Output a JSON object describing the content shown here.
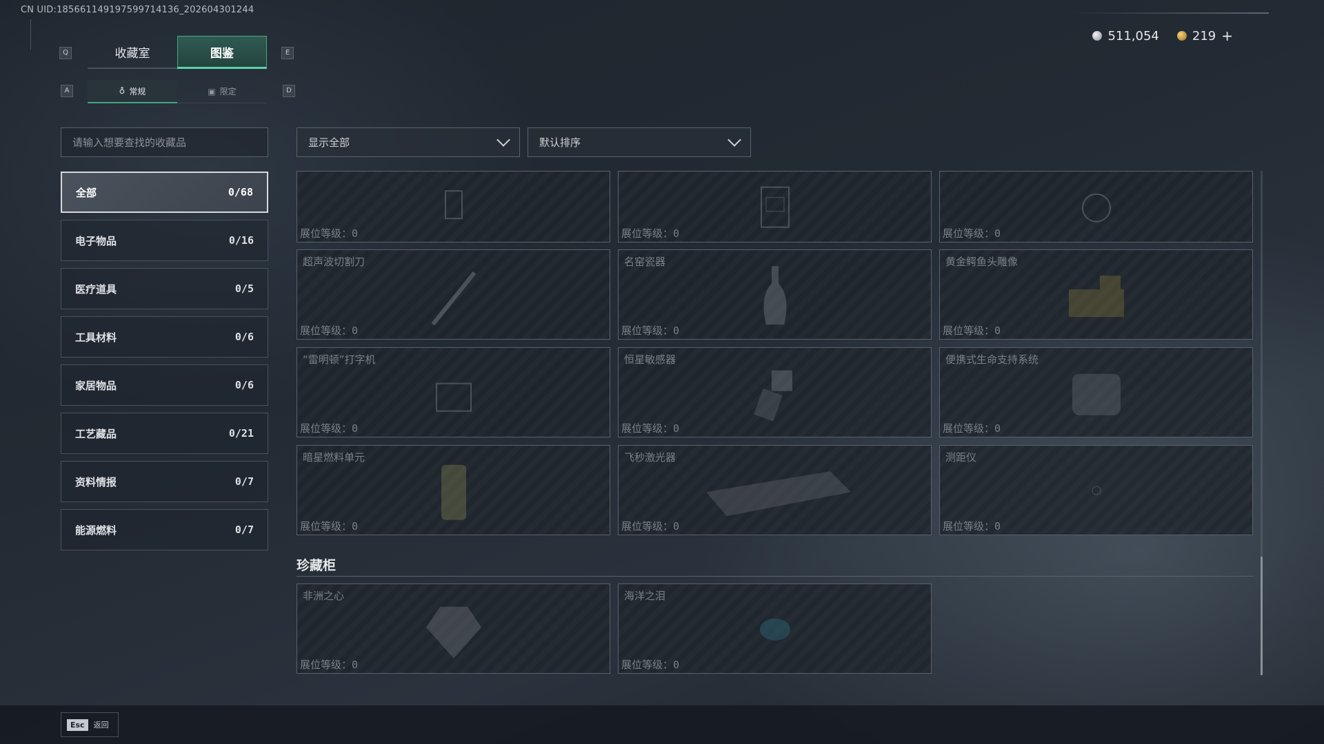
{
  "uid": "CN UID:185661149197599714136_202604301244",
  "currency": {
    "silver": "511,054",
    "gold": "219",
    "plus": "+"
  },
  "hotkeys": {
    "prev_main": "Q",
    "next_main": "E",
    "prev_sub": "A",
    "next_sub": "D"
  },
  "main_tabs": [
    {
      "label": "收藏室",
      "active": false
    },
    {
      "label": "图鉴",
      "active": true
    }
  ],
  "sub_tabs": [
    {
      "label": "常规",
      "icon": "♁",
      "active": true
    },
    {
      "label": "限定",
      "icon": "▣",
      "active": false
    }
  ],
  "search": {
    "placeholder": "请输入想要查找的收藏品"
  },
  "categories": [
    {
      "label": "全部",
      "count": "0/68",
      "active": true
    },
    {
      "label": "电子物品",
      "count": "0/16"
    },
    {
      "label": "医疗道具",
      "count": "0/5"
    },
    {
      "label": "工具材料",
      "count": "0/6"
    },
    {
      "label": "家居物品",
      "count": "0/6"
    },
    {
      "label": "工艺藏品",
      "count": "0/21"
    },
    {
      "label": "资料情报",
      "count": "0/7"
    },
    {
      "label": "能源燃料",
      "count": "0/7"
    }
  ],
  "filters": {
    "show": "显示全部",
    "sort": "默认排序"
  },
  "level_label": "展位等级：",
  "items": [
    {
      "name": "",
      "level": "0"
    },
    {
      "name": "",
      "level": "0"
    },
    {
      "name": "",
      "level": "0"
    },
    {
      "name": "超声波切割刀",
      "level": "0"
    },
    {
      "name": "名窑瓷器",
      "level": "0"
    },
    {
      "name": "黄金鳄鱼头雕像",
      "level": "0"
    },
    {
      "name": "“雷明顿”打字机",
      "level": "0"
    },
    {
      "name": "恒星敏感器",
      "level": "0"
    },
    {
      "name": "便携式生命支持系统",
      "level": "0"
    },
    {
      "name": "暗星燃料单元",
      "level": "0"
    },
    {
      "name": "飞秒激光器",
      "level": "0"
    },
    {
      "name": "测距仪",
      "level": "0"
    }
  ],
  "cabinet": {
    "title": "珍藏柜",
    "items": [
      {
        "name": "非洲之心",
        "level": "0"
      },
      {
        "name": "海洋之泪",
        "level": "0"
      }
    ]
  },
  "footer": {
    "esc_key": "Esc",
    "esc_label": "返回"
  }
}
